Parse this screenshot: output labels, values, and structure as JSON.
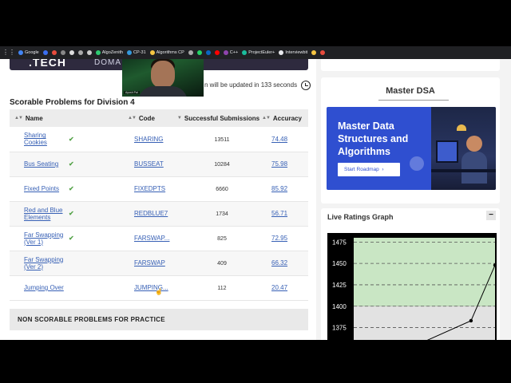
{
  "bookmarks": [
    {
      "label": "Google",
      "color": "#4285f4",
      "icon": "google-icon"
    },
    {
      "label": "",
      "color": "#3b6ff0",
      "icon": "app-icon"
    },
    {
      "label": "",
      "color": "#e84c3d",
      "icon": "app-icon"
    },
    {
      "label": "",
      "color": "#888888",
      "icon": "app-icon"
    },
    {
      "label": "",
      "color": "#dddddd",
      "icon": "app-icon"
    },
    {
      "label": "",
      "color": "#aaaaaa",
      "icon": "app-icon"
    },
    {
      "label": "",
      "color": "#cccccc",
      "icon": "app-icon"
    },
    {
      "label": "AlgoZenith",
      "color": "#2ecc71",
      "icon": "algozenith-icon"
    },
    {
      "label": "CP-31",
      "color": "#3498db",
      "icon": "cp31-icon"
    },
    {
      "label": "Algorithms CP",
      "color": "#f5c542",
      "icon": "algorithms-icon"
    },
    {
      "label": "",
      "color": "#aaaaaa",
      "icon": "app-icon"
    },
    {
      "label": "",
      "color": "#25d366",
      "icon": "whatsapp-icon"
    },
    {
      "label": "",
      "color": "#0a66c2",
      "icon": "linkedin-icon"
    },
    {
      "label": "",
      "color": "#ff0000",
      "icon": "youtube-icon"
    },
    {
      "label": "C++",
      "color": "#8e44ad",
      "icon": "cpp-icon"
    },
    {
      "label": "ProjectEuler+",
      "color": "#1abc9c",
      "icon": "projecteuler-icon"
    },
    {
      "label": "Interviewbit",
      "color": "#e8eaed",
      "icon": "interviewbit-icon"
    },
    {
      "label": "",
      "color": "#f5c542",
      "icon": "app-icon"
    },
    {
      "label": "",
      "color": "#e84c3d",
      "icon": "app-icon"
    }
  ],
  "banner": {
    "logo": ".TECH",
    "domain": "DOMA"
  },
  "webcam": {
    "name_tag": "Ayush Pal"
  },
  "update_notice": "n will be updated in 133 seconds",
  "section_title": "Scorable Problems for Division 4",
  "table": {
    "headers": {
      "name": "Name",
      "code": "Code",
      "submissions": "Successful Submissions",
      "accuracy": "Accuracy"
    },
    "rows": [
      {
        "name": "Sharing Cookies",
        "solved": true,
        "code": "SHARING",
        "submissions": "13511",
        "accuracy": "74.48"
      },
      {
        "name": "Bus Seating",
        "solved": true,
        "code": "BUSSEAT",
        "submissions": "10284",
        "accuracy": "75.98"
      },
      {
        "name": "Fixed Points",
        "solved": true,
        "code": "FIXEDPTS",
        "submissions": "6660",
        "accuracy": "85.92"
      },
      {
        "name": "Red and Blue Elements",
        "solved": true,
        "code": "REDBLUE7",
        "submissions": "1734",
        "accuracy": "56.71"
      },
      {
        "name": "Far Swapping (Ver 1)",
        "solved": true,
        "code": "FARSWAP...",
        "submissions": "825",
        "accuracy": "72.95"
      },
      {
        "name": "Far Swapping (Ver 2)",
        "solved": false,
        "code": "FARSWAP",
        "submissions": "409",
        "accuracy": "66.32"
      },
      {
        "name": "Jumping Over",
        "solved": false,
        "code": "JUMPING...",
        "submissions": "112",
        "accuracy": "20.47"
      }
    ]
  },
  "non_scorable_title": "NON SCORABLE PROBLEMS FOR PRACTICE",
  "master_dsa": {
    "title": "Master DSA",
    "ad_text": "Master Data Structures and Algorithms",
    "ad_button": "Start Roadmap"
  },
  "ratings": {
    "title": "Live Ratings Graph",
    "toggle": "−"
  },
  "chart_data": {
    "type": "line",
    "title": "",
    "y_ticks": [
      1375,
      1400,
      1425,
      1450,
      1475
    ],
    "ylim": [
      1355,
      1480
    ],
    "x_range": [
      0,
      10
    ],
    "series": [
      {
        "x": [
          4.5,
          8.3,
          10.0
        ],
        "y": [
          1355,
          1383,
          1448
        ]
      }
    ],
    "bands": [
      {
        "from": 1400,
        "to": 1480,
        "color": "#c9e6c4"
      },
      {
        "from": 1355,
        "to": 1400,
        "color": "#e2e2e2"
      }
    ],
    "grid": true,
    "line_color": "#000000"
  }
}
